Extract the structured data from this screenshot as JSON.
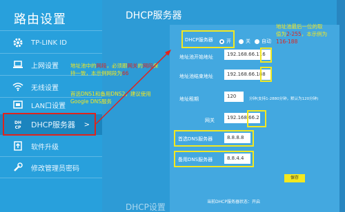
{
  "sidebar": {
    "title": "路由设置",
    "items": [
      {
        "label": "TP-LINK ID",
        "icon": "gear-icon"
      },
      {
        "label": "上网设置",
        "icon": "laptop-icon"
      },
      {
        "label": "无线设置",
        "icon": "wifi-icon"
      },
      {
        "label": "LAN口设置",
        "icon": "lan-icon"
      },
      {
        "label": "DHCP服务器",
        "icon": "dhcp-icon"
      },
      {
        "label": "软件升级",
        "icon": "upgrade-icon"
      },
      {
        "label": "修改管理员密码",
        "icon": "wrench-icon"
      }
    ],
    "active_chevron": ">"
  },
  "main": {
    "title": "DHCP服务器",
    "bottom_label": "DHCP设置"
  },
  "form": {
    "dhcp_label": "DHCP服务器",
    "radio_on": "开",
    "radio_off": "关",
    "radio_auto": "自动",
    "start_label": "地址池开始地址",
    "start_value": "192.168.66.116",
    "end_label": "地址池结束地址",
    "end_value": "192.168.66.188",
    "lease_label": "地址租期",
    "lease_value": "120",
    "lease_hint": "分钟(支持1-2880分钟，默认为120分钟)",
    "gateway_label": "网关",
    "gateway_value": "192.168.66.2",
    "dns1_label": "首选DNS服务器",
    "dns1_value": "8.8.8.8",
    "dns2_label": "备用DNS服务器",
    "dns2_value": "8.8.4.4",
    "save_label": "保存",
    "status_text": "当前DHCP服务器状态：开启"
  },
  "notes": {
    "top_right_1": "地址池最后一位的取",
    "top_right_2a": "值为",
    "top_right_2b": "2-255",
    "top_right_2c": "，本示例为",
    "top_right_3": "116-188",
    "gw_1a": "地址池中的",
    "gw_1b": "网段",
    "gw_1c": "，必须跟",
    "gw_1d": "网关",
    "gw_1e": "的",
    "gw_1f": "网段",
    "gw_1g": "保",
    "gw_2": "持一致，本示例网段为",
    "gw_2b": "66",
    "dns_1": "首选DNS1和备用DNS2，建议使用",
    "dns_2": "Google DNS服务"
  },
  "colors": {
    "background": "#2d9bd6",
    "sidebar_active": "#1b84be",
    "annotation_yellow": "#f3e81f",
    "annotation_red": "#e0231c"
  }
}
